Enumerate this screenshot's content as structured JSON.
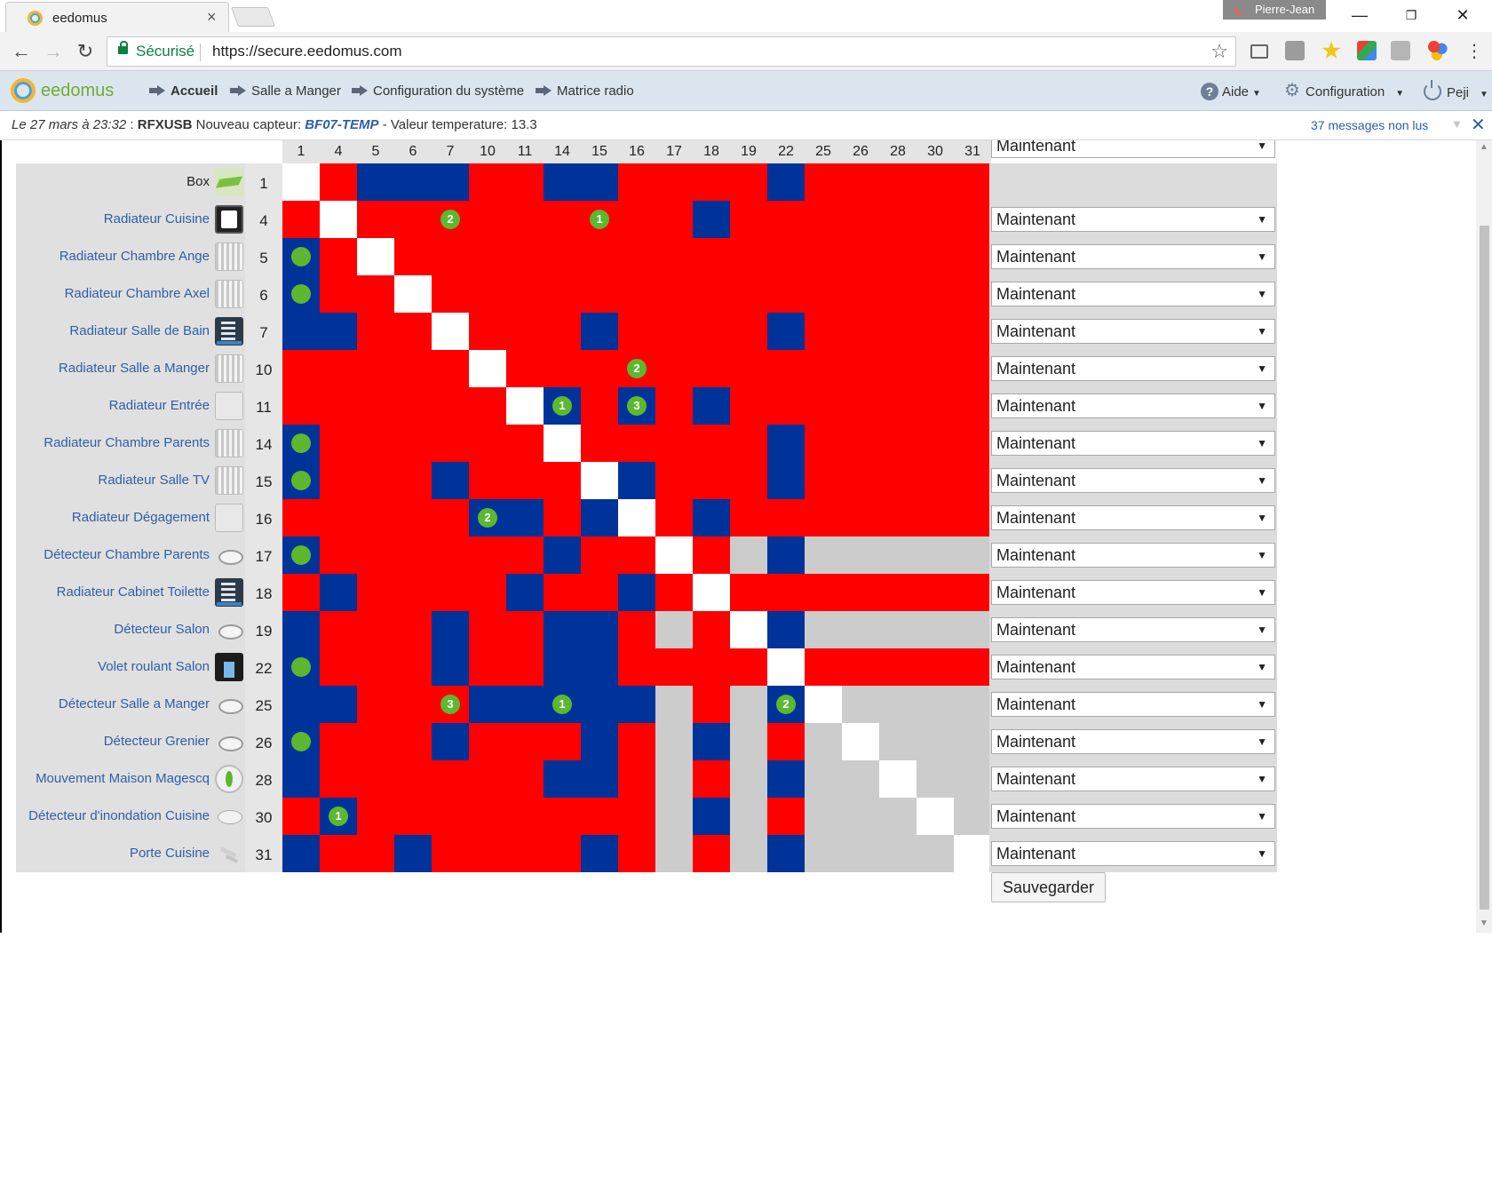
{
  "browser": {
    "tab_title": "eedomus",
    "tab_close": "×",
    "profile_name": "Pierre-Jean",
    "secure_label": "Sécurisé",
    "url": "https://secure.eedomus.com"
  },
  "app": {
    "logo_text": "eedomus",
    "nav": [
      {
        "label": "Accueil",
        "bold": true
      },
      {
        "label": "Salle a Manger",
        "bold": false
      },
      {
        "label": "Configuration du système",
        "bold": false
      },
      {
        "label": "Matrice radio",
        "bold": false
      }
    ],
    "help_label": "Aide",
    "config_label": "Configuration",
    "user_label": "Peji"
  },
  "notification": {
    "date": "Le 27 mars à 23:32",
    "separator": " : ",
    "source": "RFXUSB",
    "text1": " Nouveau capteur: ",
    "sensor": "BF07-TEMP",
    "text2": " - Valeur temperature: 13.3",
    "messages": "37 messages non lus"
  },
  "matrix": {
    "columns": [
      "1",
      "4",
      "5",
      "6",
      "7",
      "10",
      "11",
      "14",
      "15",
      "16",
      "17",
      "18",
      "19",
      "22",
      "25",
      "26",
      "28",
      "30",
      "31"
    ],
    "rows": [
      {
        "label": "Box",
        "id": "1",
        "icon": "box-icon",
        "link": false,
        "select": null,
        "cells": "wrbbbrrbbrrrrbrrrrr",
        "dots": {}
      },
      {
        "label": "Radiateur Cuisine",
        "id": "4",
        "icon": "radiator-dark-icon",
        "link": true,
        "select": "Maintenant",
        "cells": "rwrrrrrrrrrbrrrrrrr",
        "dots": {
          "4": "2",
          "8": "1"
        }
      },
      {
        "label": "Radiateur Chambre Ange",
        "id": "5",
        "icon": "radiator-icon",
        "link": true,
        "select": "Maintenant",
        "cells": "brwrrrrrrrrrrrrrrrr",
        "dots": {
          "0": ""
        }
      },
      {
        "label": "Radiateur Chambre Axel",
        "id": "6",
        "icon": "radiator-icon",
        "link": true,
        "select": "Maintenant",
        "cells": "brrwrrrrrrrrrrrrrrr",
        "dots": {
          "0": ""
        }
      },
      {
        "label": "Radiateur Salle de Bain",
        "id": "7",
        "icon": "towel-radiator-icon",
        "link": true,
        "select": "Maintenant",
        "cells": "bbrrwrrrbrrrrbrrrrr",
        "dots": {}
      },
      {
        "label": "Radiateur Salle a Manger",
        "id": "10",
        "icon": "radiator-icon",
        "link": true,
        "select": "Maintenant",
        "cells": "rrrrrwrrrrrrrrrrrrr",
        "dots": {
          "9": "2"
        }
      },
      {
        "label": "Radiateur Entrée",
        "id": "11",
        "icon": "panel-heater-icon",
        "link": true,
        "select": "Maintenant",
        "cells": "rrrrrrwbrbrbrrrrrrr",
        "dots": {
          "7": "1",
          "9": "3"
        }
      },
      {
        "label": "Radiateur Chambre Parents",
        "id": "14",
        "icon": "radiator-icon",
        "link": true,
        "select": "Maintenant",
        "cells": "brrrrrrwrrrrrbrrrrr",
        "dots": {
          "0": ""
        }
      },
      {
        "label": "Radiateur Salle TV",
        "id": "15",
        "icon": "radiator-icon",
        "link": true,
        "select": "Maintenant",
        "cells": "brrrbrrrwbrrrbrrrrr",
        "dots": {
          "0": ""
        }
      },
      {
        "label": "Radiateur Dégagement",
        "id": "16",
        "icon": "panel-heater-icon",
        "link": true,
        "select": "Maintenant",
        "cells": "rrrrrbbrbwrbrrrrrrr",
        "dots": {
          "5": "2"
        }
      },
      {
        "label": "Détecteur Chambre Parents",
        "id": "17",
        "icon": "detector-icon",
        "link": true,
        "select": "Maintenant",
        "cells": "brrrrrrbrrwrgbggggg",
        "dots": {
          "0": ""
        }
      },
      {
        "label": "Radiateur Cabinet Toilette",
        "id": "18",
        "icon": "towel-radiator-icon",
        "link": true,
        "select": "Maintenant",
        "cells": "rbrrrrbrrbrwrrrrrrr",
        "dots": {}
      },
      {
        "label": "Détecteur Salon",
        "id": "19",
        "icon": "detector-icon",
        "link": true,
        "select": "Maintenant",
        "cells": "brrrbrrbbrgrwbggggg",
        "dots": {}
      },
      {
        "label": "Volet roulant Salon",
        "id": "22",
        "icon": "shutter-icon",
        "link": true,
        "select": "Maintenant",
        "cells": "brrrbrrbbrrrrwrrrrr",
        "dots": {
          "0": ""
        }
      },
      {
        "label": "Détecteur Salle a Manger",
        "id": "25",
        "icon": "detector-icon",
        "link": true,
        "select": "Maintenant",
        "cells": "bbrrrbbbbbgrgbwgggg",
        "dots": {
          "4": "3",
          "7": "1",
          "13": "2"
        }
      },
      {
        "label": "Détecteur Grenier",
        "id": "26",
        "icon": "detector-icon",
        "link": true,
        "select": "Maintenant",
        "cells": "brrrbrrrbrgbgrgwggg",
        "dots": {
          "0": ""
        }
      },
      {
        "label": "Mouvement Maison Magescq",
        "id": "28",
        "icon": "motion-sensor-icon",
        "link": true,
        "select": "Maintenant",
        "cells": "brrrrrrbbrgrgbggwgg",
        "dots": {}
      },
      {
        "label": "Détecteur d'inondation Cuisine",
        "id": "30",
        "icon": "flood-sensor-icon",
        "link": true,
        "select": "Maintenant",
        "cells": "rbrrrrrrrrgbgrgggwg",
        "dots": {
          "1": "1"
        }
      },
      {
        "label": "Porte Cuisine",
        "id": "31",
        "icon": "door-sensor-icon",
        "link": true,
        "select": "Maintenant",
        "cells": "brrbrrrrbrgrgbggggw",
        "dots": {}
      }
    ],
    "header_select": "Maintenant",
    "save_label": "Sauvegarder"
  },
  "colors": {
    "strong": "#ff0000",
    "weak": "#003399",
    "none": "#cccccc",
    "self": "#ffffff",
    "hop": "#5cb82e"
  }
}
